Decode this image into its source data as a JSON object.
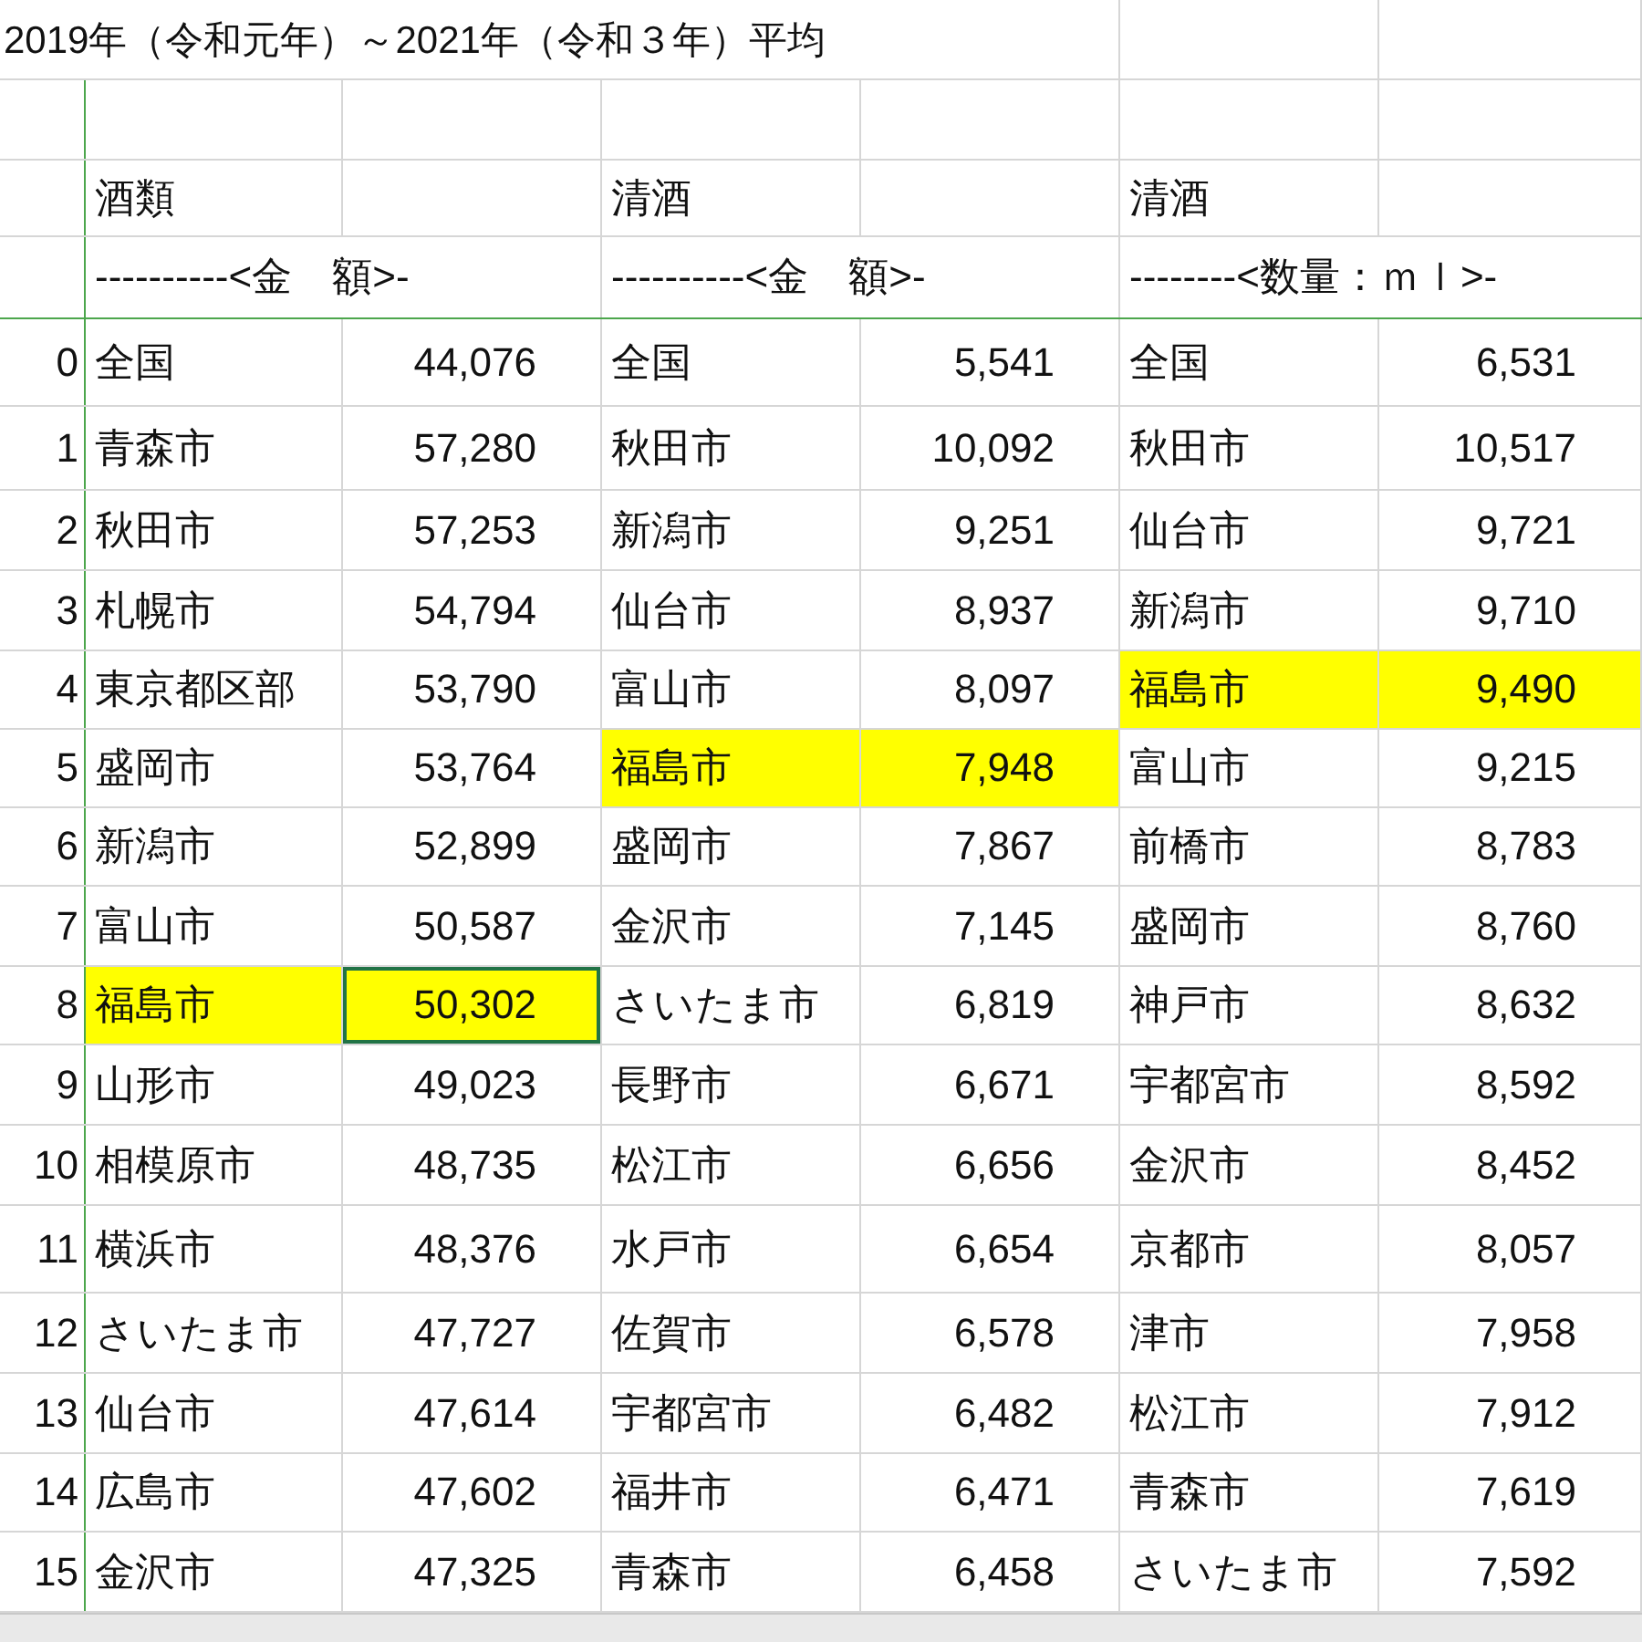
{
  "title": "2019年（令和元年）～2021年（令和３年）平均",
  "groups": [
    {
      "category": "酒類",
      "unit": "----------<金　額>-"
    },
    {
      "category": "清酒",
      "unit": "----------<金　額>-"
    },
    {
      "category": "清酒",
      "unit": "--------<数量：ｍｌ>-"
    }
  ],
  "rows": [
    {
      "index": "0",
      "groups": [
        {
          "city": "全国",
          "value": "44,076",
          "highlighted": false,
          "selected": false
        },
        {
          "city": "全国",
          "value": "5,541",
          "highlighted": false,
          "selected": false
        },
        {
          "city": "全国",
          "value": "6,531",
          "highlighted": false,
          "selected": false
        }
      ]
    },
    {
      "index": "1",
      "groups": [
        {
          "city": "青森市",
          "value": "57,280",
          "highlighted": false,
          "selected": false
        },
        {
          "city": "秋田市",
          "value": "10,092",
          "highlighted": false,
          "selected": false
        },
        {
          "city": "秋田市",
          "value": "10,517",
          "highlighted": false,
          "selected": false
        }
      ]
    },
    {
      "index": "2",
      "groups": [
        {
          "city": "秋田市",
          "value": "57,253",
          "highlighted": false,
          "selected": false
        },
        {
          "city": "新潟市",
          "value": "9,251",
          "highlighted": false,
          "selected": false
        },
        {
          "city": "仙台市",
          "value": "9,721",
          "highlighted": false,
          "selected": false
        }
      ]
    },
    {
      "index": "3",
      "groups": [
        {
          "city": "札幌市",
          "value": "54,794",
          "highlighted": false,
          "selected": false
        },
        {
          "city": "仙台市",
          "value": "8,937",
          "highlighted": false,
          "selected": false
        },
        {
          "city": "新潟市",
          "value": "9,710",
          "highlighted": false,
          "selected": false
        }
      ]
    },
    {
      "index": "4",
      "groups": [
        {
          "city": "東京都区部",
          "value": "53,790",
          "highlighted": false,
          "selected": false
        },
        {
          "city": "富山市",
          "value": "8,097",
          "highlighted": false,
          "selected": false
        },
        {
          "city": "福島市",
          "value": "9,490",
          "highlighted": true,
          "selected": false
        }
      ]
    },
    {
      "index": "5",
      "groups": [
        {
          "city": "盛岡市",
          "value": "53,764",
          "highlighted": false,
          "selected": false
        },
        {
          "city": "福島市",
          "value": "7,948",
          "highlighted": true,
          "selected": false
        },
        {
          "city": "富山市",
          "value": "9,215",
          "highlighted": false,
          "selected": false
        }
      ]
    },
    {
      "index": "6",
      "groups": [
        {
          "city": "新潟市",
          "value": "52,899",
          "highlighted": false,
          "selected": false
        },
        {
          "city": "盛岡市",
          "value": "7,867",
          "highlighted": false,
          "selected": false
        },
        {
          "city": "前橋市",
          "value": "8,783",
          "highlighted": false,
          "selected": false
        }
      ]
    },
    {
      "index": "7",
      "groups": [
        {
          "city": "富山市",
          "value": "50,587",
          "highlighted": false,
          "selected": false
        },
        {
          "city": "金沢市",
          "value": "7,145",
          "highlighted": false,
          "selected": false
        },
        {
          "city": "盛岡市",
          "value": "8,760",
          "highlighted": false,
          "selected": false
        }
      ]
    },
    {
      "index": "8",
      "groups": [
        {
          "city": "福島市",
          "value": "50,302",
          "highlighted": true,
          "selected": true
        },
        {
          "city": "さいたま市",
          "value": "6,819",
          "highlighted": false,
          "selected": false
        },
        {
          "city": "神戸市",
          "value": "8,632",
          "highlighted": false,
          "selected": false
        }
      ]
    },
    {
      "index": "9",
      "groups": [
        {
          "city": "山形市",
          "value": "49,023",
          "highlighted": false,
          "selected": false
        },
        {
          "city": "長野市",
          "value": "6,671",
          "highlighted": false,
          "selected": false
        },
        {
          "city": "宇都宮市",
          "value": "8,592",
          "highlighted": false,
          "selected": false
        }
      ]
    },
    {
      "index": "10",
      "groups": [
        {
          "city": "相模原市",
          "value": "48,735",
          "highlighted": false,
          "selected": false
        },
        {
          "city": "松江市",
          "value": "6,656",
          "highlighted": false,
          "selected": false
        },
        {
          "city": "金沢市",
          "value": "8,452",
          "highlighted": false,
          "selected": false
        }
      ]
    },
    {
      "index": "11",
      "groups": [
        {
          "city": "横浜市",
          "value": "48,376",
          "highlighted": false,
          "selected": false
        },
        {
          "city": "水戸市",
          "value": "6,654",
          "highlighted": false,
          "selected": false
        },
        {
          "city": "京都市",
          "value": "8,057",
          "highlighted": false,
          "selected": false
        }
      ]
    },
    {
      "index": "12",
      "groups": [
        {
          "city": "さいたま市",
          "value": "47,727",
          "highlighted": false,
          "selected": false
        },
        {
          "city": "佐賀市",
          "value": "6,578",
          "highlighted": false,
          "selected": false
        },
        {
          "city": "津市",
          "value": "7,958",
          "highlighted": false,
          "selected": false
        }
      ]
    },
    {
      "index": "13",
      "groups": [
        {
          "city": "仙台市",
          "value": "47,614",
          "highlighted": false,
          "selected": false
        },
        {
          "city": "宇都宮市",
          "value": "6,482",
          "highlighted": false,
          "selected": false
        },
        {
          "city": "松江市",
          "value": "7,912",
          "highlighted": false,
          "selected": false
        }
      ]
    },
    {
      "index": "14",
      "groups": [
        {
          "city": "広島市",
          "value": "47,602",
          "highlighted": false,
          "selected": false
        },
        {
          "city": "福井市",
          "value": "6,471",
          "highlighted": false,
          "selected": false
        },
        {
          "city": "青森市",
          "value": "7,619",
          "highlighted": false,
          "selected": false
        }
      ]
    },
    {
      "index": "15",
      "groups": [
        {
          "city": "金沢市",
          "value": "47,325",
          "highlighted": false,
          "selected": false
        },
        {
          "city": "青森市",
          "value": "6,458",
          "highlighted": false,
          "selected": false
        },
        {
          "city": "さいたま市",
          "value": "7,592",
          "highlighted": false,
          "selected": false
        }
      ]
    }
  ]
}
